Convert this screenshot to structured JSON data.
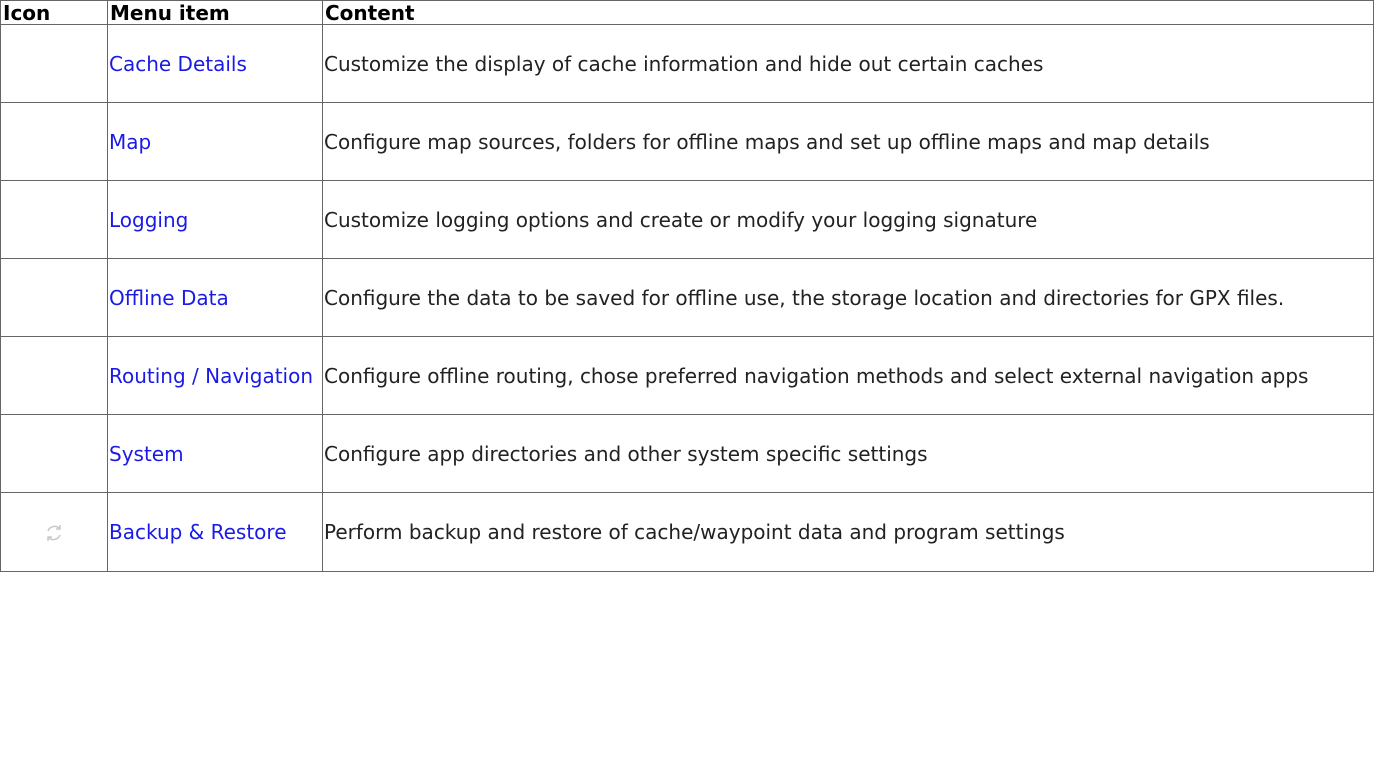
{
  "table": {
    "headers": {
      "icon": "Icon",
      "menu_item": "Menu item",
      "content": "Content"
    },
    "rows": [
      {
        "icon": "",
        "menu_item": "Cache Details",
        "content": "Customize the display of cache information and hide out certain caches"
      },
      {
        "icon": "",
        "menu_item": "Map",
        "content": "Configure map sources, folders for offline maps and set up offline maps and map details"
      },
      {
        "icon": "",
        "menu_item": "Logging",
        "content": "Customize logging options and create or modify your logging signature"
      },
      {
        "icon": "",
        "menu_item": "Offline Data",
        "content": "Configure the data to be saved for offline use, the storage location and directories for GPX files."
      },
      {
        "icon": "",
        "menu_item": "Routing / Navigation",
        "content": "Configure offline routing, chose preferred navigation methods and select external navigation apps"
      },
      {
        "icon": "",
        "menu_item": "System",
        "content": "Configure app directories and other system specific settings"
      },
      {
        "icon": "sync-icon",
        "menu_item": "Backup & Restore",
        "content": "Perform backup and restore of cache/waypoint data and program settings"
      }
    ]
  },
  "colors": {
    "link": "#1a1ae6",
    "border": "#666666",
    "text": "#222222"
  }
}
